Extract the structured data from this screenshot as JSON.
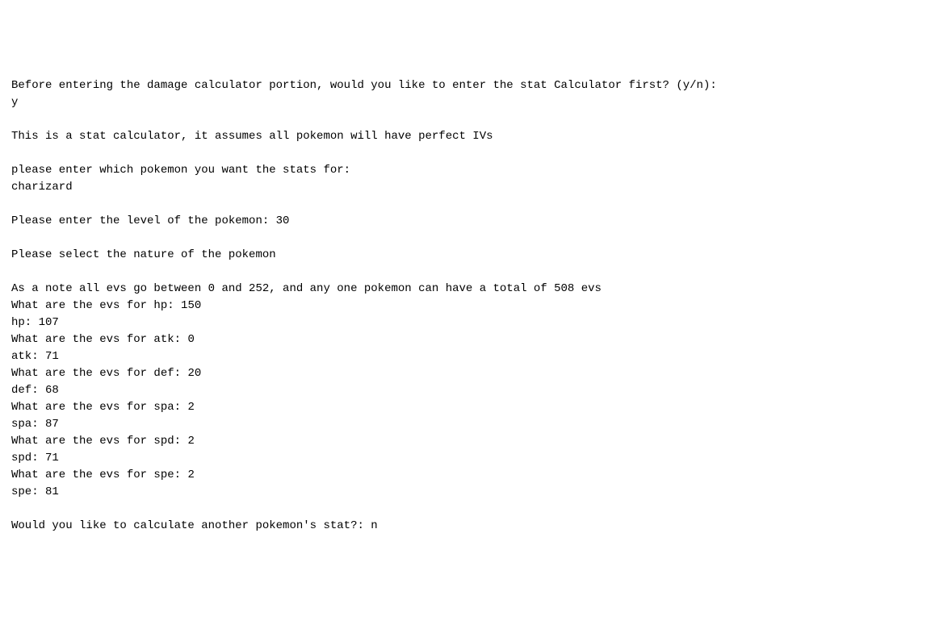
{
  "lines": {
    "prompt_stat_calc": "Before entering the damage calculator portion, would you like to enter the stat Calculator first? (y/n):",
    "input_stat_calc": "y",
    "blank1": " ",
    "intro": "This is a stat calculator, it assumes all pokemon will have perfect IVs",
    "blank2": " ",
    "prompt_pokemon": "please enter which pokemon you want the stats for:",
    "input_pokemon": "charizard",
    "blank3": " ",
    "prompt_level": "Please enter the level of the pokemon: ",
    "input_level": "30",
    "blank4": " ",
    "prompt_nature": "Please select the nature of the pokemon",
    "blank5": " ",
    "ev_note": "As a note all evs go between 0 and 252, and any one pokemon can have a total of 508 evs",
    "prompt_hp": "What are the evs for hp: ",
    "input_hp": "150",
    "result_hp": "hp: 107",
    "prompt_atk": "What are the evs for atk: ",
    "input_atk": "0",
    "result_atk": "atk: 71",
    "prompt_def": "What are the evs for def: ",
    "input_def": "20",
    "result_def": "def: 68",
    "prompt_spa": "What are the evs for spa: ",
    "input_spa": "2",
    "result_spa": "spa: 87",
    "prompt_spd": "What are the evs for spd: ",
    "input_spd": "2",
    "result_spd": "spd: 71",
    "prompt_spe": "What are the evs for spe: ",
    "input_spe": "2",
    "result_spe": "spe: 81",
    "blank6": " ",
    "prompt_again": "Would you like to calculate another pokemon's stat?: ",
    "input_again": "n"
  }
}
